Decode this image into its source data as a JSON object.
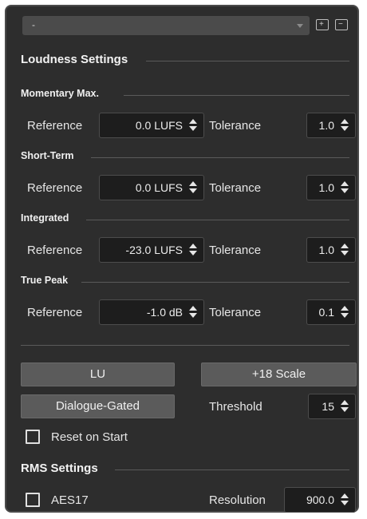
{
  "header": {
    "preset_value": "-",
    "save_icon": "add-preset-icon",
    "delete_icon": "remove-preset-icon"
  },
  "loudness": {
    "title": "Loudness Settings",
    "momentary": {
      "title": "Momentary Max.",
      "reference_label": "Reference",
      "reference_value": "0.0 LUFS",
      "tolerance_label": "Tolerance",
      "tolerance_value": "1.0"
    },
    "short_term": {
      "title": "Short-Term",
      "reference_label": "Reference",
      "reference_value": "0.0 LUFS",
      "tolerance_label": "Tolerance",
      "tolerance_value": "1.0"
    },
    "integrated": {
      "title": "Integrated",
      "reference_label": "Reference",
      "reference_value": "-23.0 LUFS",
      "tolerance_label": "Tolerance",
      "tolerance_value": "1.0"
    },
    "true_peak": {
      "title": "True Peak",
      "reference_label": "Reference",
      "reference_value": "-1.0 dB",
      "tolerance_label": "Tolerance",
      "tolerance_value": "0.1"
    }
  },
  "controls": {
    "lu_label": "LU",
    "scale_label": "+18 Scale",
    "dialogue_label": "Dialogue-Gated",
    "threshold_label": "Threshold",
    "threshold_value": "15",
    "reset_label": "Reset on Start",
    "reset_checked": false
  },
  "rms": {
    "title": "RMS Settings",
    "aes17_label": "AES17",
    "aes17_checked": false,
    "resolution_label": "Resolution",
    "resolution_value": "900.0"
  }
}
